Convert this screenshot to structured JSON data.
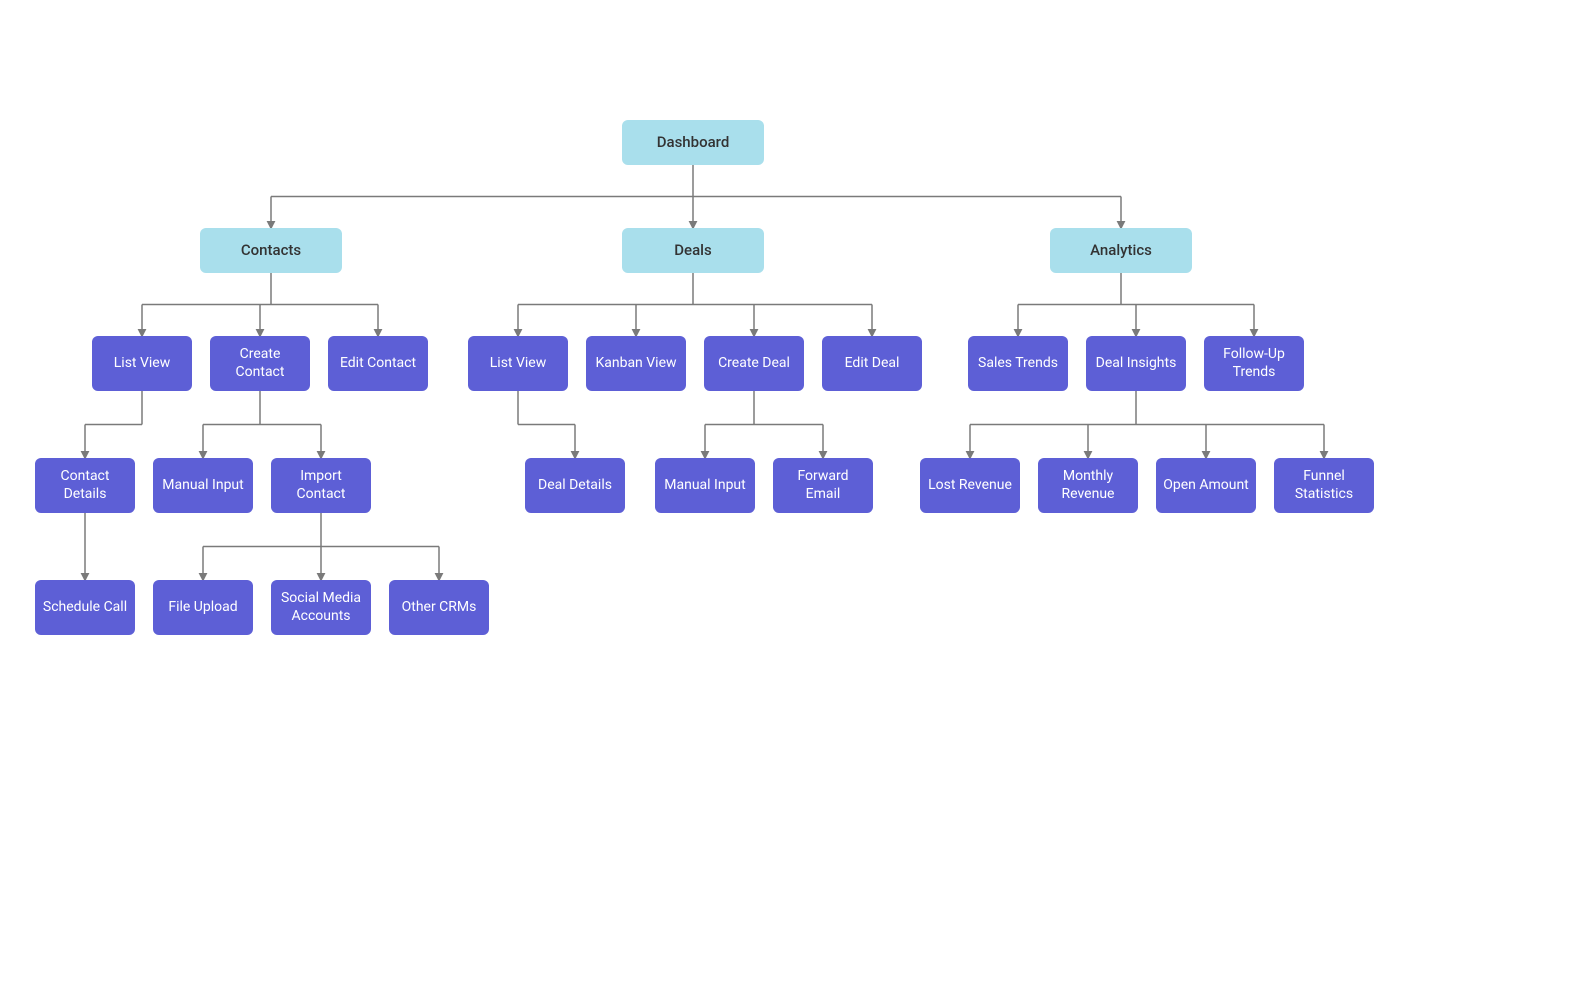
{
  "colors": {
    "light_node": "#A9DFEC",
    "purple_node": "#5D5FD6",
    "connector": "#7A7A7A",
    "text_dark": "#333333",
    "text_light": "#FFFFFF"
  },
  "tree": {
    "root": "Dashboard",
    "branches": [
      {
        "label": "Contacts",
        "children": [
          {
            "label": "List View",
            "children": [
              {
                "label": "Contact Details",
                "children": [
                  {
                    "label": "Schedule Call"
                  }
                ]
              }
            ]
          },
          {
            "label": "Create Contact",
            "children": [
              {
                "label": "Manual Input"
              },
              {
                "label": "Import Contact",
                "children": [
                  {
                    "label": "File Upload"
                  },
                  {
                    "label": "Social Media Accounts"
                  },
                  {
                    "label": "Other CRMs"
                  }
                ]
              }
            ]
          },
          {
            "label": "Edit Contact"
          }
        ]
      },
      {
        "label": "Deals",
        "children": [
          {
            "label": "List View",
            "children": [
              {
                "label": "Deal Details"
              }
            ]
          },
          {
            "label": "Kanban View"
          },
          {
            "label": "Create Deal",
            "children": [
              {
                "label": "Manual Input"
              },
              {
                "label": "Forward Email"
              }
            ]
          },
          {
            "label": "Edit Deal"
          }
        ]
      },
      {
        "label": "Analytics",
        "children": [
          {
            "label": "Sales Trends"
          },
          {
            "label": "Deal Insights",
            "children": [
              {
                "label": "Lost Revenue"
              },
              {
                "label": "Monthly Revenue"
              },
              {
                "label": "Open Amount"
              },
              {
                "label": "Funnel Statistics"
              }
            ]
          },
          {
            "label": "Follow-Up Trends"
          }
        ]
      }
    ]
  }
}
